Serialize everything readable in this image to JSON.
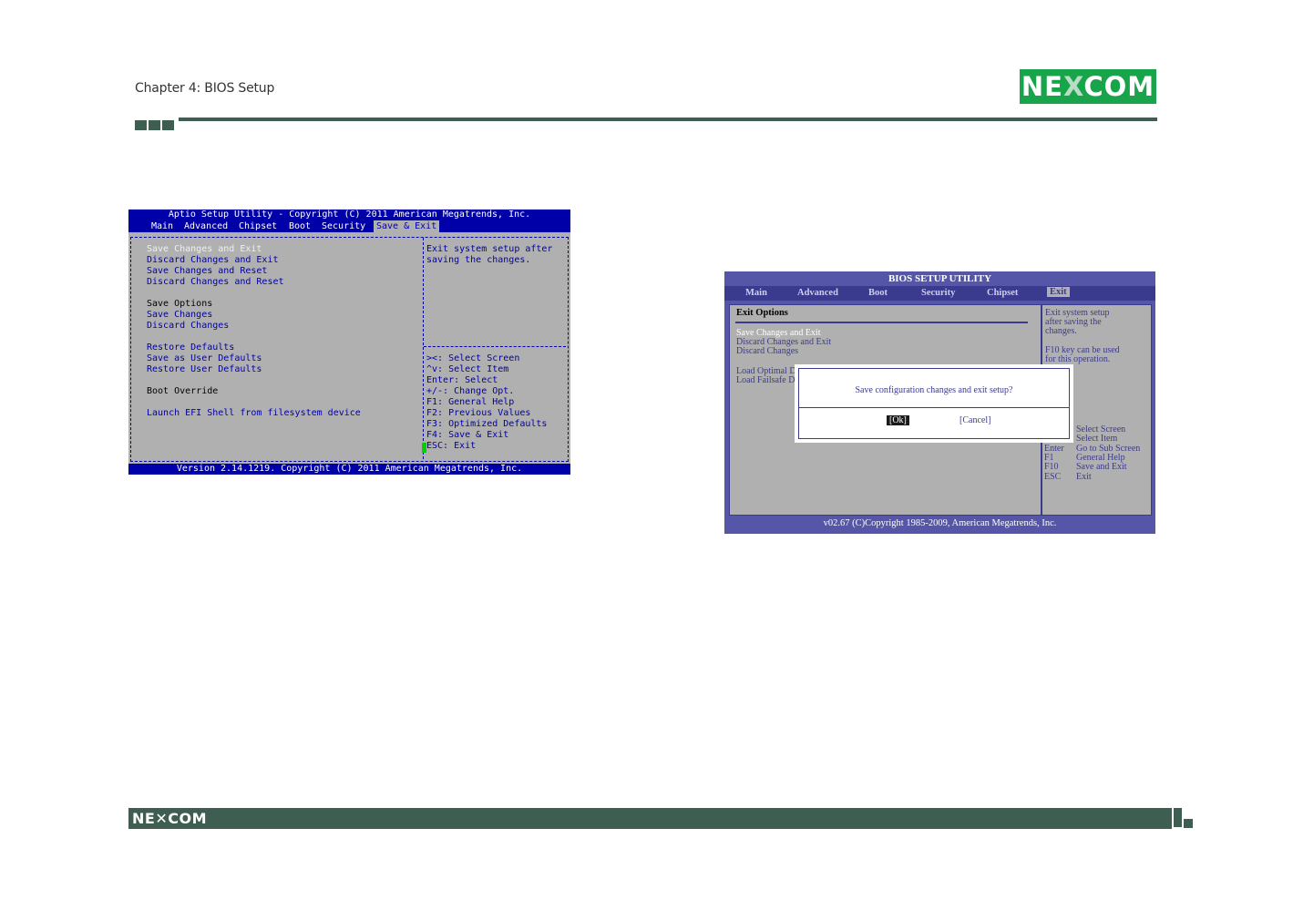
{
  "header": {
    "chapter_title": "Chapter 4: BIOS Setup",
    "logo_left": "NE",
    "logo_x": "X",
    "logo_right": "COM"
  },
  "footer": {
    "logo_text": "NE✕COM"
  },
  "aptio": {
    "title": "Aptio Setup Utility - Copyright (C) 2011 American Megatrends, Inc.",
    "tabs": [
      "Main",
      "Advanced",
      "Chipset",
      "Boot",
      "Security",
      "Save & Exit"
    ],
    "selected_tab": "Save & Exit",
    "items": {
      "save_changes_and_exit": "Save Changes and Exit",
      "discard_changes_and_exit": "Discard Changes and Exit",
      "save_changes_and_reset": "Save Changes and Reset",
      "discard_changes_and_reset": "Discard Changes and Reset",
      "save_options_header": "Save Options",
      "save_changes": "Save Changes",
      "discard_changes": "Discard Changes",
      "restore_defaults": "Restore Defaults",
      "save_as_user_defaults": "Save as User Defaults",
      "restore_user_defaults": "Restore User Defaults",
      "boot_override_header": "Boot Override",
      "launch_efi_shell": "Launch EFI Shell from filesystem device"
    },
    "help_line1": "Exit system setup after",
    "help_line2": "saving the changes.",
    "keys": [
      "><: Select Screen",
      "^v: Select Item",
      "Enter: Select",
      "+/-: Change Opt.",
      "F1: General Help",
      "F2: Previous Values",
      "F3: Optimized Defaults",
      "F4: Save & Exit",
      "ESC: Exit"
    ],
    "footer": "Version 2.14.1219. Copyright (C) 2011 American Megatrends, Inc."
  },
  "ami": {
    "title": "BIOS SETUP UTILITY",
    "tabs": [
      "Main",
      "Advanced",
      "Boot",
      "Security",
      "Chipset",
      "Exit"
    ],
    "selected_tab": "Exit",
    "section_title": "Exit Options",
    "items": {
      "save_changes_and_exit": "Save Changes and Exit",
      "discard_changes_and_exit": "Discard Changes and Exit",
      "discard_changes": "Discard Changes",
      "load_optimal": "Load Optimal D",
      "load_failsafe": "Load Failsafe D"
    },
    "help": {
      "line1": "Exit system setup",
      "line2": "after saving the",
      "line3": "changes.",
      "line4": "F10 key can be used",
      "line5": "for this operation."
    },
    "keys": [
      {
        "key": "",
        "desc": "Select Screen"
      },
      {
        "key": "↑↓",
        "desc": "Select Item"
      },
      {
        "key": "Enter",
        "desc": "Go to Sub Screen"
      },
      {
        "key": "F1",
        "desc": "General Help"
      },
      {
        "key": "F10",
        "desc": "Save and Exit"
      },
      {
        "key": "ESC",
        "desc": "Exit"
      }
    ],
    "dialog": {
      "question": "Save configuration changes and exit setup?",
      "ok": "[Ok]",
      "cancel": "[Cancel]"
    },
    "footer": "v02.67 (C)Copyright 1985-2009, American Megatrends, Inc."
  }
}
